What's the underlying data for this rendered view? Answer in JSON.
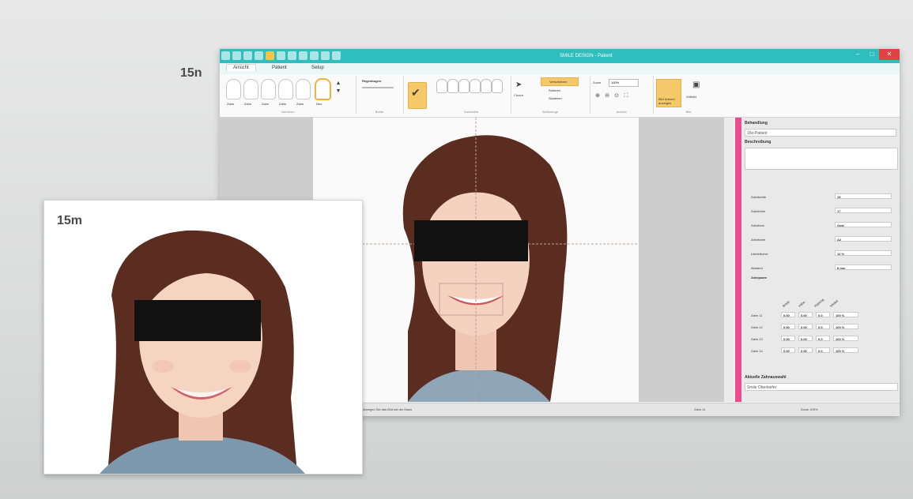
{
  "figure_labels": {
    "top": "15n",
    "bottom": "15m"
  },
  "app": {
    "window_title": "SMILE DESIGN - Patient",
    "tabs": [
      "Ansicht",
      "Patient",
      "Setup"
    ],
    "ribbon": {
      "tooth_labels": [
        "Zahn",
        "Zahn",
        "Zahn",
        "Zahn",
        "Zahn",
        "Zahn"
      ],
      "selected_tooth_label": "Neu",
      "regenbogen_label": "Regenbogen",
      "set_button_label": "Set\nZähne",
      "cursor_label": "Cursor",
      "tool_items": [
        "Verschieben",
        "Rotieren",
        "Skalieren"
      ],
      "zoom_label": "Zoom",
      "zoom_value": "100%",
      "export_button_label": "Bild fixieren\nanzeigen",
      "fullscreen_label": "Vollbild",
      "group_labels": [
        "Zahnform",
        "Breite",
        "Zahnreihe",
        "Werkzeuge",
        "Ansicht",
        "Bild"
      ]
    },
    "panel": {
      "title": "Behandlung",
      "title_value": "15n-Patient",
      "description_label": "Beschreibung",
      "params": [
        {
          "label": "Zahnbreite",
          "value": "15"
        },
        {
          "label": "Zahnhöhe",
          "value": "17"
        },
        {
          "label": "Zahnform",
          "value": "Oval"
        },
        {
          "label": "Zahnfarbe",
          "value": "A2"
        },
        {
          "label": "Lächelkurve",
          "value": "12 %"
        },
        {
          "label": "Abstand",
          "value": "8 mm"
        }
      ],
      "columns_label": "Zahnpaare",
      "column_heads": [
        "Breite",
        "Höhe",
        "Kippung",
        "Winkel"
      ],
      "rows": [
        {
          "label": "Zahn 11",
          "values": [
            "0.00",
            "0.00",
            "0.0",
            "100 %"
          ]
        },
        {
          "label": "Zahn 12",
          "values": [
            "0.00",
            "0.00",
            "0.0",
            "100 %"
          ]
        },
        {
          "label": "Zahn 13",
          "values": [
            "0.00",
            "0.00",
            "0.0",
            "100 %"
          ]
        },
        {
          "label": "Zahn 14",
          "values": [
            "0.00",
            "0.00",
            "0.0",
            "100 %"
          ]
        }
      ],
      "bottom_label": "Aktuelle Zahnauswahl",
      "bottom_value": "Smile Oberkiefer"
    },
    "status": {
      "left": "Bewegen Sie das Bild mit der Maus",
      "mid": "Zahn 11",
      "right": "Zoom 100%"
    }
  },
  "colors": {
    "titlebar": "#2fbdbd",
    "accent_pink": "#e94d8e",
    "highlight": "#f5c96a",
    "close": "#e04343"
  },
  "icons": [
    "save-icon",
    "cursor-icon",
    "zoom-in-icon",
    "zoom-out-icon",
    "check-icon",
    "close-icon",
    "minimize-icon",
    "maximize-icon"
  ]
}
